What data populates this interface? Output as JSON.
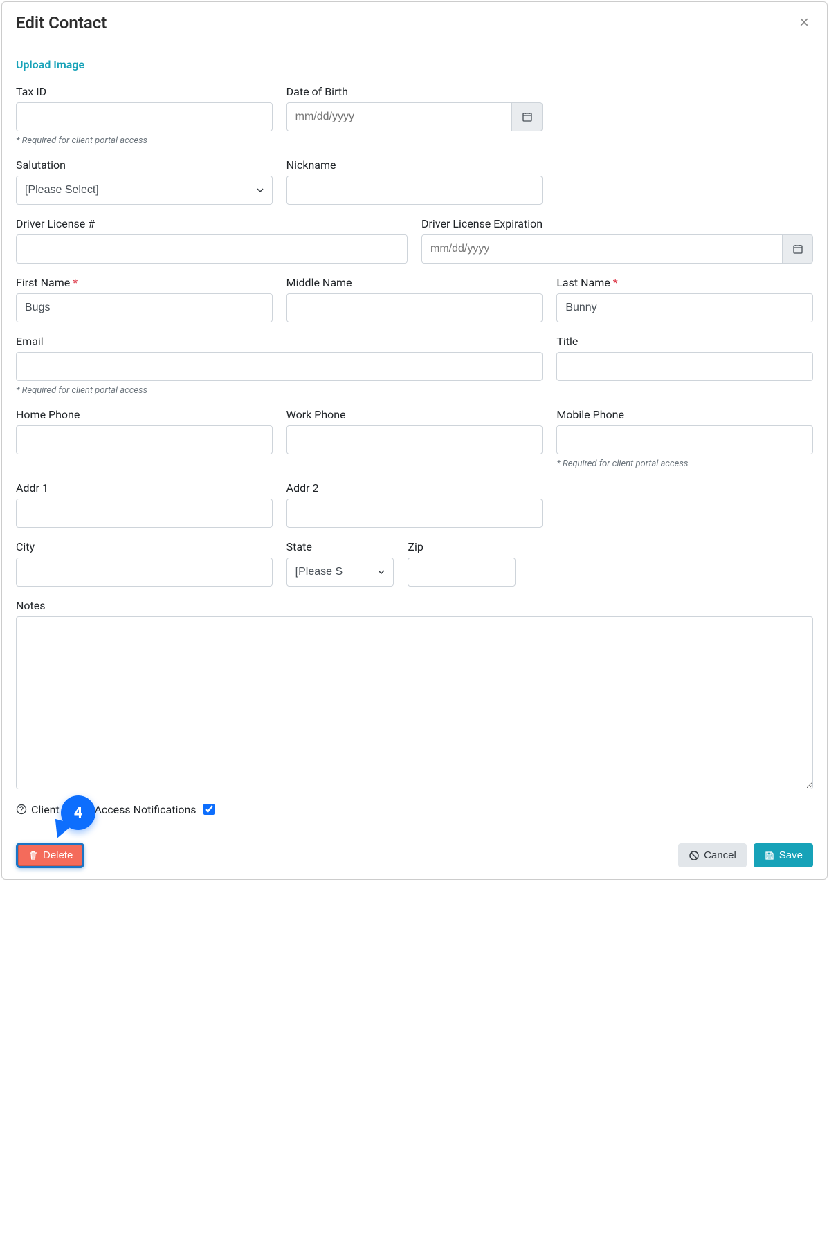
{
  "modal": {
    "title": "Edit Contact"
  },
  "uploadImage": "Upload Image",
  "labels": {
    "taxId": "Tax ID",
    "dob": "Date of Birth",
    "salutation": "Salutation",
    "nickname": "Nickname",
    "driverLicense": "Driver License #",
    "dlExpiration": "Driver License Expiration",
    "firstName": "First Name",
    "middleName": "Middle Name",
    "lastName": "Last Name",
    "email": "Email",
    "title": "Title",
    "homePhone": "Home Phone",
    "workPhone": "Work Phone",
    "mobilePhone": "Mobile Phone",
    "addr1": "Addr 1",
    "addr2": "Addr 2",
    "city": "City",
    "state": "State",
    "zip": "Zip",
    "notes": "Notes",
    "clientPortal": "Client Portal Access Notifications"
  },
  "placeholders": {
    "date": "mm/dd/yyyy"
  },
  "helpText": {
    "requiredPortal": "* Required for client portal access"
  },
  "values": {
    "taxId": "",
    "dob": "",
    "salutation": "[Please Select]",
    "nickname": "",
    "driverLicense": "",
    "dlExpiration": "",
    "firstName": "Bugs",
    "middleName": "",
    "lastName": "Bunny",
    "email": "",
    "title": "",
    "homePhone": "",
    "workPhone": "",
    "mobilePhone": "",
    "addr1": "",
    "addr2": "",
    "city": "",
    "state": "[Please S",
    "zip": "",
    "notes": "",
    "clientPortalChecked": true
  },
  "buttons": {
    "delete": "Delete",
    "cancel": "Cancel",
    "save": "Save"
  },
  "callout": {
    "number": "4"
  }
}
